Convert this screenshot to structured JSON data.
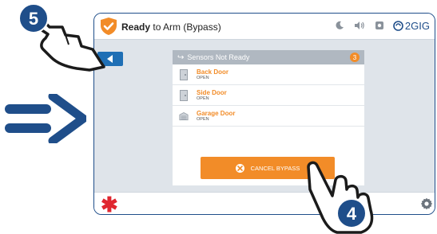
{
  "header": {
    "status_bold": "Ready",
    "status_rest": " to Arm (Bypass)",
    "brand": "2GIG"
  },
  "panel": {
    "title": "Sensors Not Ready",
    "count": "3",
    "sensors": [
      {
        "name": "Back Door",
        "state": "OPEN",
        "icon": "door-icon"
      },
      {
        "name": "Side Door",
        "state": "OPEN",
        "icon": "door-icon"
      },
      {
        "name": "Garage Door",
        "state": "OPEN",
        "icon": "garage-icon"
      }
    ]
  },
  "cancel_button": {
    "label": "CANCEL BYPASS"
  },
  "callouts": {
    "step_top": "5",
    "step_bottom": "4"
  },
  "colors": {
    "accent": "#f28c28",
    "brand_blue": "#1f4e8a",
    "alert_red": "#e0262f"
  }
}
